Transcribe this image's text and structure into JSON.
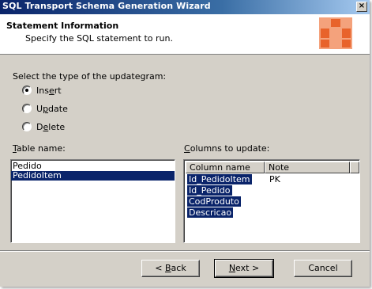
{
  "window": {
    "title": "SQL Transport Schema Generation Wizard",
    "close_glyph": "×"
  },
  "header": {
    "heading": "Statement Information",
    "subheading": "Specify the SQL statement to run.",
    "logo_colors": [
      "#e8632b",
      "#f4a27c"
    ]
  },
  "updategram": {
    "label": "Select the type of the updategram:",
    "options": [
      {
        "pre": "Ins",
        "key": "e",
        "post": "rt",
        "checked": true
      },
      {
        "pre": "U",
        "key": "p",
        "post": "date",
        "checked": false
      },
      {
        "pre": "D",
        "key": "e",
        "post": "lete",
        "checked": false
      }
    ]
  },
  "tables": {
    "label_key": "T",
    "label_rest": "able name:",
    "items": [
      {
        "name": "Pedido",
        "selected": false
      },
      {
        "name": "PedidoItem",
        "selected": true
      }
    ]
  },
  "columns": {
    "label_key": "C",
    "label_rest": "olumns to update:",
    "headers": [
      "Column name",
      "Note"
    ],
    "rows": [
      {
        "name": "Id_PedidoItem",
        "note": "PK"
      },
      {
        "name": "Id_Pedido",
        "note": ""
      },
      {
        "name": "CodProduto",
        "note": ""
      },
      {
        "name": "Descricao",
        "note": ""
      }
    ]
  },
  "buttons": {
    "back_pre": "< ",
    "back_key": "B",
    "back_post": "ack",
    "next_key": "N",
    "next_post": "ext >",
    "cancel": "Cancel"
  }
}
